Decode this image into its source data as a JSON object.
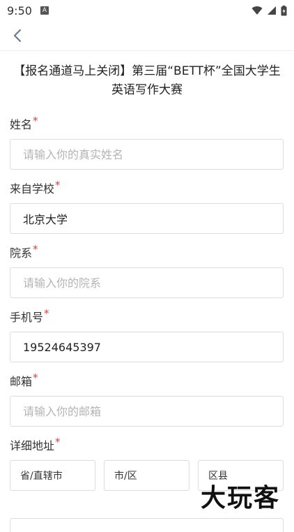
{
  "status_bar": {
    "time": "9:50",
    "notification_letter": "A"
  },
  "page": {
    "title": "【报名通道马上关闭】第三届“BETT杯”全国大学生英语写作大赛"
  },
  "form": {
    "required_mark": "*",
    "fields": [
      {
        "label": "姓名",
        "value": "",
        "placeholder": "请输入你的真实姓名"
      },
      {
        "label": "来自学校",
        "value": "北京大学",
        "placeholder": ""
      },
      {
        "label": "院系",
        "value": "",
        "placeholder": "请输入你的院系"
      },
      {
        "label": "手机号",
        "value": "19524645397",
        "placeholder": ""
      },
      {
        "label": "邮箱",
        "value": "",
        "placeholder": "请输入你的邮箱"
      }
    ],
    "address": {
      "label": "详细地址",
      "province": "省/直辖市",
      "city": "市/区",
      "district": "区县"
    }
  },
  "watermark": {
    "text": "大玩客"
  }
}
